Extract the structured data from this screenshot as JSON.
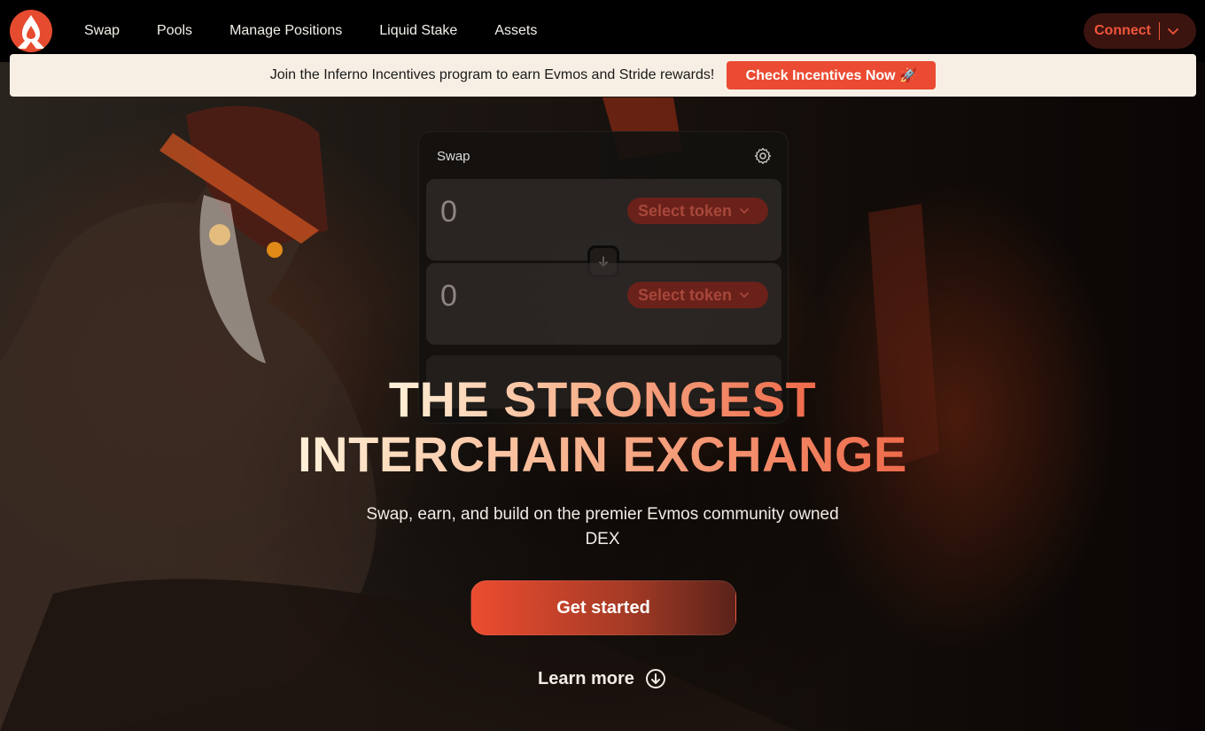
{
  "nav": {
    "logo_icon": "flame-logo-icon",
    "links": [
      "Swap",
      "Pools",
      "Manage Positions",
      "Liquid Stake",
      "Assets"
    ],
    "connect_label": "Connect"
  },
  "banner": {
    "text": "Join the Inferno Incentives program to earn Evmos and Stride rewards!",
    "button_label": "Check Incentives Now 🚀"
  },
  "swap": {
    "title": "Swap",
    "settings_icon": "gear-icon",
    "from_amount": "0",
    "to_amount": "0",
    "select_token_label": "Select token",
    "arrow_icon": "arrow-down-icon"
  },
  "hero": {
    "title_line1": "THE STRONGEST",
    "title_line2": "INTERCHAIN EXCHANGE",
    "subtitle": "Swap, earn, and build on the premier Evmos community owned DEX",
    "cta_label": "Get started",
    "learn_more_label": "Learn more"
  },
  "colors": {
    "accent": "#ea4b32",
    "banner_bg": "#f7efe4",
    "nav_bg": "#000000"
  }
}
